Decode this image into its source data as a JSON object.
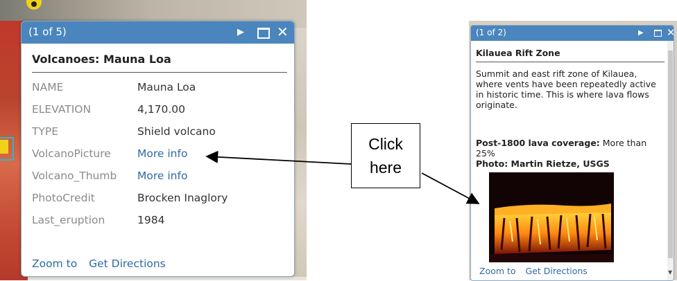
{
  "popup_left": {
    "counter": "(1 of 5)",
    "title": "Volcanoes: Mauna Loa",
    "attributes": [
      {
        "key": "NAME",
        "value": "Mauna Loa",
        "link": false
      },
      {
        "key": "ELEVATION",
        "value": "4,170.00",
        "link": false
      },
      {
        "key": "TYPE",
        "value": "Shield volcano",
        "link": false
      },
      {
        "key": "VolcanoPicture",
        "value": "More info",
        "link": true
      },
      {
        "key": "Volcano_Thumb",
        "value": "More info",
        "link": true
      },
      {
        "key": "PhotoCredit",
        "value": "Brocken Inaglory",
        "link": false
      },
      {
        "key": "Last_eruption",
        "value": "1984",
        "link": false
      }
    ],
    "zoom_label": "Zoom to",
    "directions_label": "Get Directions"
  },
  "callout": {
    "line1": "Click",
    "line2": "here"
  },
  "popup_right": {
    "counter": "(1 of 2)",
    "title": "Kilauea Rift Zone",
    "description": "Summit and east rift zone of Kilauea, where vents have been repeatedly active in historic time. This is where lava flows originate.",
    "coverage_label": "Post-1800 lava coverage:",
    "coverage_value": " More than 25%",
    "photo_credit": "Photo: Martin Rietze, USGS",
    "zoom_label": "Zoom to",
    "directions_label": "Get Directions"
  },
  "icons": {
    "next": "play-triangle",
    "maximize": "window-maximize",
    "close": "x-close"
  },
  "colors": {
    "titlebar": "#4a86bd",
    "link": "#2d6aa6",
    "label_gray": "#8a8a8a"
  }
}
